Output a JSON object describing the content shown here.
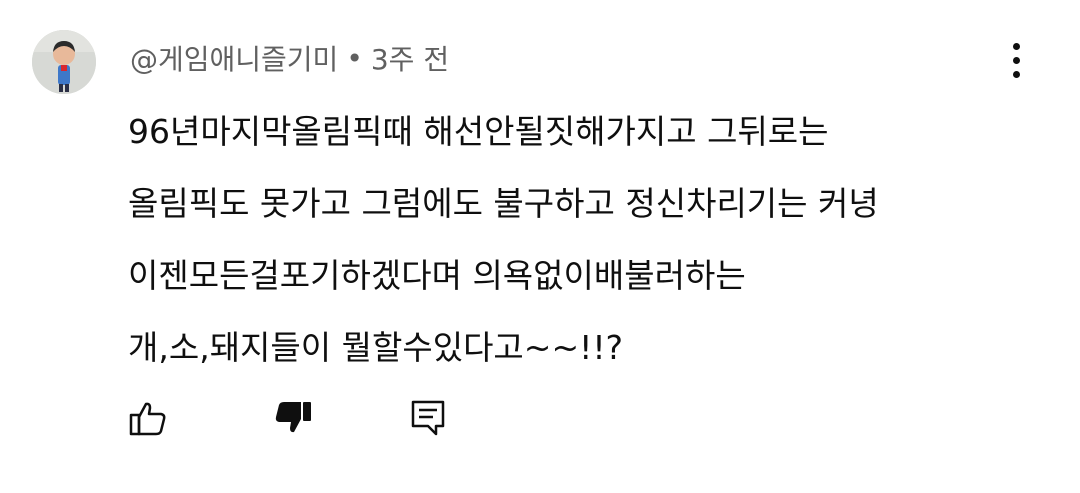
{
  "comment": {
    "author": "@게임애니즐기미",
    "separator": "•",
    "time_ago": "3주 전",
    "lines": [
      "96년마지막올림픽때 해선안될짓해가지고 그뒤로는",
      "올림픽도 못가고 그럼에도 불구하고 정신차리기는 커녕",
      "이젠모든걸포기하겠다며 의욕없이배불러하는",
      "개,소,돼지들이 뭘할수있다고~~!!?"
    ],
    "icons": {
      "avatar": "avatar-image",
      "menu": "more-vert-icon",
      "like": "thumb-up-icon",
      "dislike": "thumb-down-filled-icon",
      "reply": "comment-reply-icon"
    },
    "colors": {
      "text": "#0f0f0f",
      "meta": "#606060",
      "background": "#ffffff"
    }
  }
}
